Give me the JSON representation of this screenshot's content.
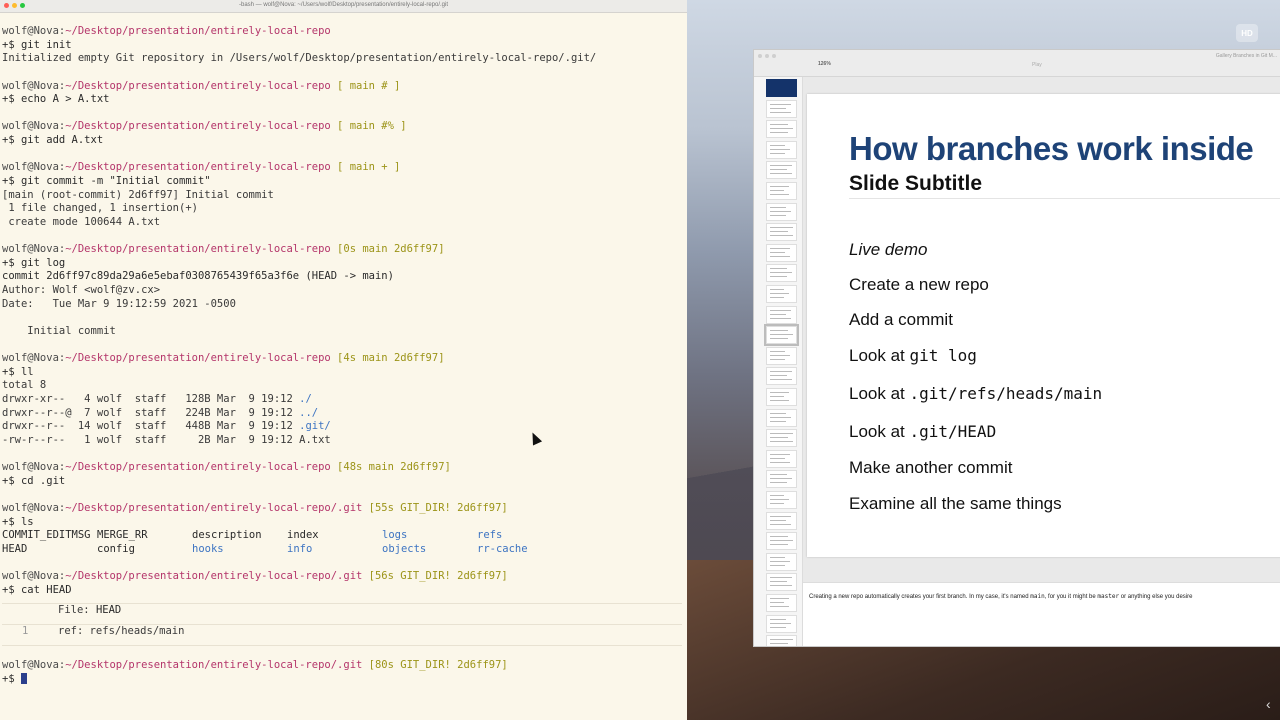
{
  "terminal": {
    "title": "-bash — wolf@Nova: ~/Users/wolf/Desktop/presentation/entirely-local-repo/.git",
    "user_host": "wolf@Nova:",
    "lines": [
      {
        "kind": "prompt",
        "path": "~/Desktop/presentation/entirely-local-repo",
        "status": ""
      },
      {
        "kind": "cmd",
        "text": "+$ git init"
      },
      {
        "kind": "out",
        "text": "Initialized empty Git repository in /Users/wolf/Desktop/presentation/entirely-local-repo/.git/"
      },
      {
        "kind": "blank"
      },
      {
        "kind": "prompt",
        "path": "~/Desktop/presentation/entirely-local-repo",
        "status": " [ main # ]"
      },
      {
        "kind": "cmd",
        "text": "+$ echo A > A.txt"
      },
      {
        "kind": "blank"
      },
      {
        "kind": "prompt",
        "path": "~/Desktop/presentation/entirely-local-repo",
        "status": " [ main #% ]"
      },
      {
        "kind": "cmd",
        "text": "+$ git add A.txt"
      },
      {
        "kind": "blank"
      },
      {
        "kind": "prompt",
        "path": "~/Desktop/presentation/entirely-local-repo",
        "status": " [ main + ]"
      },
      {
        "kind": "cmd",
        "text": "+$ git commit -m \"Initial commit\""
      },
      {
        "kind": "out",
        "text": "[main (root-commit) 2d6ff97] Initial commit"
      },
      {
        "kind": "out",
        "text": " 1 file changed, 1 insertion(+)"
      },
      {
        "kind": "out",
        "text": " create mode 100644 A.txt"
      },
      {
        "kind": "blank"
      },
      {
        "kind": "prompt",
        "path": "~/Desktop/presentation/entirely-local-repo",
        "status": " [0s main 2d6ff97]"
      },
      {
        "kind": "cmd",
        "text": "+$ git log"
      },
      {
        "kind": "commit",
        "text": "commit 2d6ff97c89da29a6e5ebaf0308765439f65a3f6e",
        "ref": " (HEAD -> main)"
      },
      {
        "kind": "out",
        "text": "Author: Wolf <wolf@zv.cx>"
      },
      {
        "kind": "out",
        "text": "Date:   Tue Mar 9 19:12:59 2021 -0500"
      },
      {
        "kind": "blank"
      },
      {
        "kind": "out",
        "text": "    Initial commit"
      },
      {
        "kind": "blank"
      },
      {
        "kind": "prompt",
        "path": "~/Desktop/presentation/entirely-local-repo",
        "status": " [4s main 2d6ff97]"
      },
      {
        "kind": "cmd",
        "text": "+$ ll"
      },
      {
        "kind": "out",
        "text": "total 8"
      },
      {
        "kind": "ls",
        "text": "drwxr-xr--   4 wolf  staff   128B Mar  9 19:12 ",
        "name": "./"
      },
      {
        "kind": "ls",
        "text": "drwxr--r--@  7 wolf  staff   224B Mar  9 19:12 ",
        "name": "../"
      },
      {
        "kind": "ls",
        "text": "drwxr--r--  14 wolf  staff   448B Mar  9 19:12 ",
        "name": ".git/"
      },
      {
        "kind": "ls",
        "text": "-rw-r--r--   1 wolf  staff     2B Mar  9 19:12 ",
        "name": "A.txt",
        "plain": true
      },
      {
        "kind": "blank"
      },
      {
        "kind": "prompt",
        "path": "~/Desktop/presentation/entirely-local-repo",
        "status": " [48s main 2d6ff97]"
      },
      {
        "kind": "cmd",
        "text": "+$ cd .git"
      },
      {
        "kind": "blank"
      },
      {
        "kind": "prompt",
        "path": "~/Desktop/presentation/entirely-local-repo/.git",
        "status": " [55s GIT_DIR! 2d6ff97]"
      },
      {
        "kind": "cmd",
        "text": "+$ ls"
      },
      {
        "kind": "cols",
        "items": [
          [
            "COMMIT_EDITMSG",
            "f"
          ],
          [
            "MERGE_RR",
            "f"
          ],
          [
            "description",
            "f"
          ],
          [
            "index",
            "f"
          ],
          [
            "logs",
            "d"
          ],
          [
            "refs",
            "d"
          ]
        ]
      },
      {
        "kind": "cols",
        "items": [
          [
            "HEAD",
            "f"
          ],
          [
            "config",
            "f"
          ],
          [
            "hooks",
            "d"
          ],
          [
            "info",
            "d"
          ],
          [
            "objects",
            "d"
          ],
          [
            "rr-cache",
            "d"
          ]
        ]
      },
      {
        "kind": "blank"
      },
      {
        "kind": "prompt",
        "path": "~/Desktop/presentation/entirely-local-repo/.git",
        "status": " [56s GIT_DIR! 2d6ff97]"
      },
      {
        "kind": "cmd",
        "text": "+$ cat HEAD"
      },
      {
        "kind": "sep"
      },
      {
        "kind": "bathead",
        "label": "File: ",
        "name": "HEAD"
      },
      {
        "kind": "sep"
      },
      {
        "kind": "batline",
        "num": "1",
        "text": "ref: refs/heads/main"
      },
      {
        "kind": "sep"
      },
      {
        "kind": "blank"
      },
      {
        "kind": "prompt",
        "path": "~/Desktop/presentation/entirely-local-repo/.git",
        "status": " [80s GIT_DIR! 2d6ff97]"
      },
      {
        "kind": "cursor",
        "text": "+$ "
      }
    ]
  },
  "keynote": {
    "doc_title": "Gallery Branches in Git M...",
    "zoom": "126%",
    "play_label": "Play",
    "slide": {
      "title": "How branches work inside",
      "subtitle": "Slide Subtitle",
      "bullets": [
        {
          "text": "Live demo",
          "italic": true
        },
        {
          "text": "Create a new repo"
        },
        {
          "text": "Add a commit"
        },
        {
          "text": "Look at ",
          "code": "git log"
        },
        {
          "text": "Look at ",
          "code": ".git/refs/heads/main"
        },
        {
          "text": "Look at ",
          "code": ".git/HEAD"
        },
        {
          "text": "Make another commit"
        },
        {
          "text": "Examine all the same things"
        }
      ]
    },
    "notes": {
      "part1": "Creating a new repo automatically creates your first branch.  In my case, it's named ",
      "code1": "main",
      "part2": ", for you it might be ",
      "code2": "master",
      "part3": " or anything else you desire"
    }
  },
  "desktop": {
    "badge": "HD"
  },
  "colors": {
    "prompt_path": "#b4356a",
    "status": "#9c9418",
    "dir": "#3d74c2",
    "slide_title": "#1e4377"
  }
}
